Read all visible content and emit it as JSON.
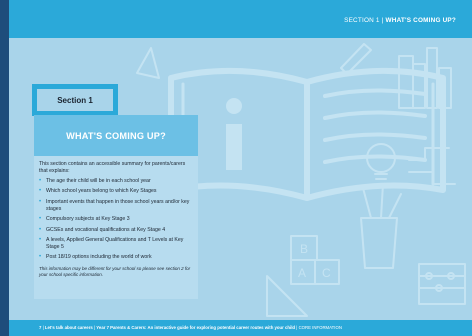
{
  "header": {
    "section": "SECTION 1",
    "separator": "|",
    "title": "WHAT'S COMING UP?"
  },
  "tab": {
    "label": "Section 1"
  },
  "panel": {
    "title": "WHAT'S COMING UP?",
    "intro": "This section contains an accessible summary for parents/carers that explains:",
    "bullets": [
      "The age their child will be in each school year",
      "Which school years belong to which Key Stages",
      "Important events that happen in those school years and/or key stages",
      "Compulsory subjects at Key Stage 3",
      "GCSEs and vocational qualifications at Key Stage 4",
      "A levels, Applied General Qualifications and T Levels at Key Stage 5",
      "Post 18/19 options including the world of work"
    ],
    "note": "This information may be different for your school so please see section 2 for your school specific information."
  },
  "footer": {
    "page": "7",
    "sep1": "|",
    "title": "Let's talk about careers",
    "sep2": "|",
    "audience": "Year 7 Parents & Carers: An interactive guide for exploring potential career routes with your child",
    "sep3": "|",
    "category": "CORE INFORMATION"
  },
  "colors": {
    "accent": "#2ba9d9",
    "background": "#a9d4ea",
    "dark_stripe": "#1e4d7b",
    "panel_title": "#6cc0e5"
  },
  "icons": [
    "open-book-icon",
    "info-i-icon",
    "pencil-icon",
    "ruler-icon",
    "books-icon",
    "lightbulb-icon",
    "abc-blocks-icon",
    "pencil-cup-icon",
    "abacus-icon",
    "cone-icon",
    "circuit-icon"
  ]
}
